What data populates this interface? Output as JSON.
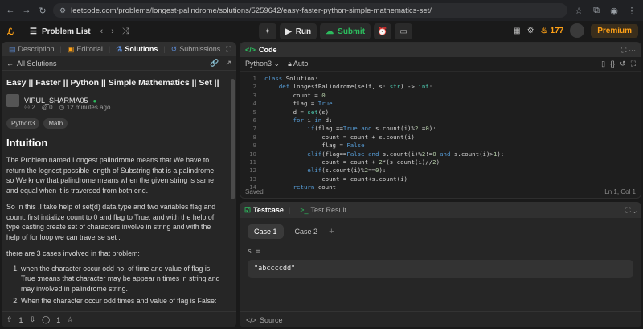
{
  "browser": {
    "url": "leetcode.com/problems/longest-palindrome/solutions/5259642/easy-faster-python-simple-mathematics-set/"
  },
  "appbar": {
    "problem_list": "Problem List",
    "run": "Run",
    "submit": "Submit",
    "streak": "177",
    "premium": "Premium"
  },
  "left": {
    "tabs": [
      {
        "label": "Description"
      },
      {
        "label": "Editorial"
      },
      {
        "label": "Solutions"
      },
      {
        "label": "Submissions"
      }
    ],
    "back": "All Solutions",
    "title": "Easy || Faster || Python || Simple Mathematics || Set ||",
    "author": "VIPUL_SHARMA05",
    "views": "2",
    "comments_count": "0",
    "posted": "12 minutes ago",
    "tags": [
      "Python3",
      "Math"
    ],
    "heading": "Intuition",
    "p1": "The Problem named Longest palindrome means that We have to return the lognest possible length of Substring that is a palindrome. so We know that palindrome means when the given string is same and equal when it is traversed from both end.",
    "p2": "So In this ,I take help of set(d) data type and two variables flag and count. first intialize count to 0 and flag to True. and with the help of type casting create set of characters involve in string and with the help of for loop we can traverse set .",
    "p3": "there are 3 cases involved in that problem:",
    "list": [
      "when the character occur odd no. of time and value of flag is True :means that character may be appear n times in string and may involved in palindrome string.",
      "When the character occur odd times and value of flag is False:"
    ],
    "upvotes": "1",
    "comments": "1"
  },
  "code": {
    "header": "Code",
    "language": "Python3",
    "mode": "Auto",
    "lines": [
      "class Solution:",
      "    def longestPalindrome(self, s: str) -> int:",
      "        count = 0",
      "        flag = True",
      "        d = set(s)",
      "        for i in d:",
      "            if(flag ==True and s.count(i)%2!=0):",
      "                count = count + s.count(i)",
      "                flag = False",
      "            elif(flag==False and s.count(i)%2!=0 and s.count(i)>1):",
      "                count = count + 2*(s.count(i)//2)",
      "            elif(s.count(i)%2==0):",
      "                count = count+s.count(i)",
      "        return count"
    ],
    "saved": "Saved",
    "position": "Ln 1, Col 1"
  },
  "test": {
    "tab_testcase": "Testcase",
    "tab_result": "Test Result",
    "cases": [
      "Case 1",
      "Case 2"
    ],
    "var_label": "s =",
    "var_value": "\"abccccdd\"",
    "source": "Source"
  }
}
